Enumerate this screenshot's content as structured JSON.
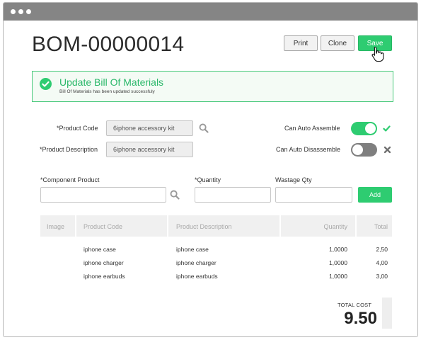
{
  "window": {
    "dots": 3
  },
  "header": {
    "title": "BOM-00000014"
  },
  "toolbar": {
    "print_label": "Print",
    "clone_label": "Clone",
    "save_label": "Save"
  },
  "alert": {
    "title": "Update Bill Of Materials",
    "message": "Bill Of Materials has been updated successfuly",
    "color": "#2ecc71"
  },
  "form": {
    "product_code_label": "*Product Code",
    "product_code_value": "6iphone accessory kit",
    "product_description_label": "*Product Description",
    "product_description_value": "6iphone accessory kit",
    "can_auto_assemble_label": "Can Auto Assemble",
    "can_auto_assemble": true,
    "can_auto_disassemble_label": "Can Auto Disassemble",
    "can_auto_disassemble": false
  },
  "component_form": {
    "component_product_label": "*Component Product",
    "component_product_value": "",
    "quantity_label": "*Quantity",
    "quantity_value": "",
    "wastage_label": "Wastage Qty",
    "wastage_value": "",
    "add_label": "Add"
  },
  "table": {
    "columns": [
      "Image",
      "Product Code",
      "Product Description",
      "Quantity",
      "Total"
    ],
    "rows": [
      {
        "code": "iphone case",
        "description": "iphone case",
        "quantity": "1,0000",
        "total": "2,50"
      },
      {
        "code": "iphone charger",
        "description": "iphone charger",
        "quantity": "1,0000",
        "total": "4,00"
      },
      {
        "code": "iphone earbuds",
        "description": "iphone earbuds",
        "quantity": "1,0000",
        "total": "3,00"
      }
    ]
  },
  "summary": {
    "total_cost_label": "TOTAL COST",
    "total_cost_value": "9.50"
  },
  "colors": {
    "accent": "#2ecc71",
    "titlebar": "#858585",
    "toggle_off": "#7f7f7f"
  },
  "icons": [
    "check-circle-icon",
    "search-icon",
    "check-icon",
    "close-icon",
    "hand-pointer-icon"
  ]
}
